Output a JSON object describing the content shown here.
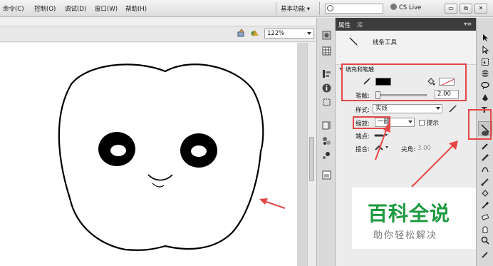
{
  "menubar": {
    "items": [
      "命令(C)",
      "控制(O)",
      "调试(D)",
      "窗口(W)",
      "帮助(H)"
    ],
    "workspace": "基本功能 ▾",
    "search_placeholder": "",
    "cslive": "CS Live"
  },
  "window_buttons": [
    "▭",
    "⧉",
    "✕"
  ],
  "stage": {
    "zoom": "122%"
  },
  "properties": {
    "tabs": [
      "属性",
      "库"
    ],
    "menu_glyph": "▾≡",
    "tool_name": "线条工具",
    "fill_header": "填充和笔触",
    "stroke_label": "笔触:",
    "stroke_value": "2.00",
    "style_label": "样式:",
    "style_value": "实线",
    "scale_label": "缩放:",
    "scale_value": "一般",
    "hint_label": "提示",
    "cap_label": "端点:",
    "join_label": "接合:",
    "miter_label": "尖角:",
    "miter_value": "3.00"
  },
  "watermark": {
    "logo": "百科全说",
    "subtitle": "助你轻松解决"
  },
  "colors": {
    "annotation": "#e64646",
    "stroke_color": "#000000",
    "watermark_green": "#1c9a3f"
  }
}
